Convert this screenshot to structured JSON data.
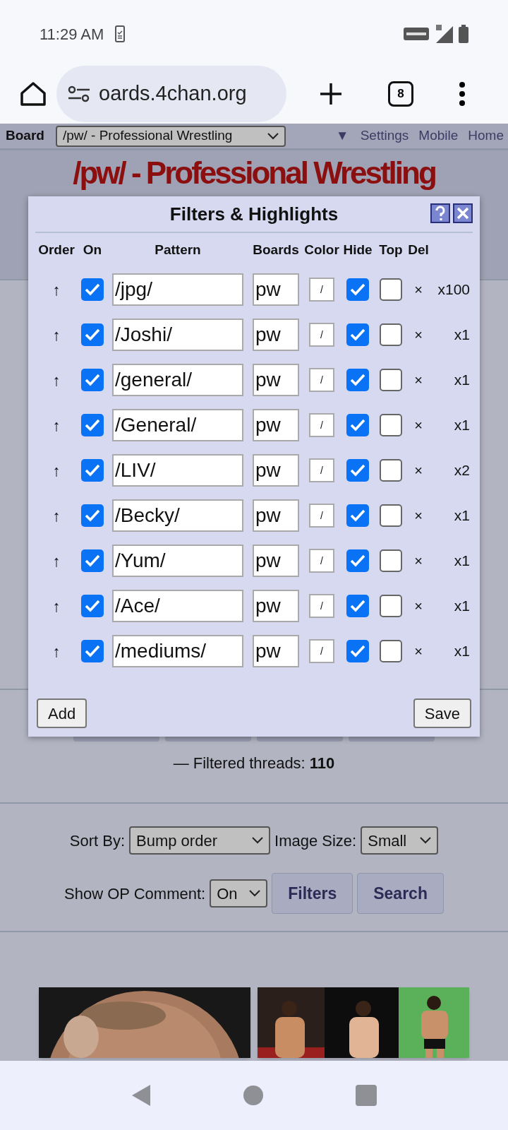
{
  "status_bar": {
    "time": "11:29 AM"
  },
  "browser": {
    "url": "oards.4chan.org",
    "tab_count": "8"
  },
  "board_nav": {
    "label": "Board",
    "board_select": "/pw/ - Professional Wrestling",
    "toggle": "▼",
    "links": [
      "Settings",
      "Mobile",
      "Home"
    ]
  },
  "board_title": "/pw/ - Professional Wrestling",
  "filters_dialog": {
    "title": "Filters & Highlights",
    "columns": [
      "Order",
      "On",
      "Pattern",
      "Boards",
      "Color",
      "Hide",
      "Top",
      "Del"
    ],
    "rows": [
      {
        "order": "↑",
        "on": true,
        "pattern": "/jpg/",
        "boards": "pw",
        "color_glyph": "/",
        "hide": true,
        "top": false,
        "delete": "×",
        "count": "x100"
      },
      {
        "order": "↑",
        "on": true,
        "pattern": "/Joshi/",
        "boards": "pw",
        "color_glyph": "/",
        "hide": true,
        "top": false,
        "delete": "×",
        "count": "x1"
      },
      {
        "order": "↑",
        "on": true,
        "pattern": "/general/",
        "boards": "pw",
        "color_glyph": "/",
        "hide": true,
        "top": false,
        "delete": "×",
        "count": "x1"
      },
      {
        "order": "↑",
        "on": true,
        "pattern": "/General/",
        "boards": "pw",
        "color_glyph": "/",
        "hide": true,
        "top": false,
        "delete": "×",
        "count": "x1"
      },
      {
        "order": "↑",
        "on": true,
        "pattern": "/LIV/",
        "boards": "pw",
        "color_glyph": "/",
        "hide": true,
        "top": false,
        "delete": "×",
        "count": "x2"
      },
      {
        "order": "↑",
        "on": true,
        "pattern": "/Becky/",
        "boards": "pw",
        "color_glyph": "/",
        "hide": true,
        "top": false,
        "delete": "×",
        "count": "x1"
      },
      {
        "order": "↑",
        "on": true,
        "pattern": "/Yum/",
        "boards": "pw",
        "color_glyph": "/",
        "hide": true,
        "top": false,
        "delete": "×",
        "count": "x1"
      },
      {
        "order": "↑",
        "on": true,
        "pattern": "/Ace/",
        "boards": "pw",
        "color_glyph": "/",
        "hide": true,
        "top": false,
        "delete": "×",
        "count": "x1"
      },
      {
        "order": "↑",
        "on": true,
        "pattern": "/mediums/",
        "boards": "pw",
        "color_glyph": "/",
        "hide": true,
        "top": false,
        "delete": "×",
        "count": "x1"
      }
    ],
    "buttons": [
      "Add",
      "Save"
    ]
  },
  "filtered_threads": "— Filtered threads: **110**",
  "controls": {
    "sort_label": "Sort By:",
    "sort_value": "Bump order",
    "image_size_label": "Image Size:",
    "image_size_value": "Small",
    "op_comment_label": "Show OP Comment:",
    "op_comment_value": "On",
    "buttons": [
      "Filters",
      "Search"
    ]
  }
}
